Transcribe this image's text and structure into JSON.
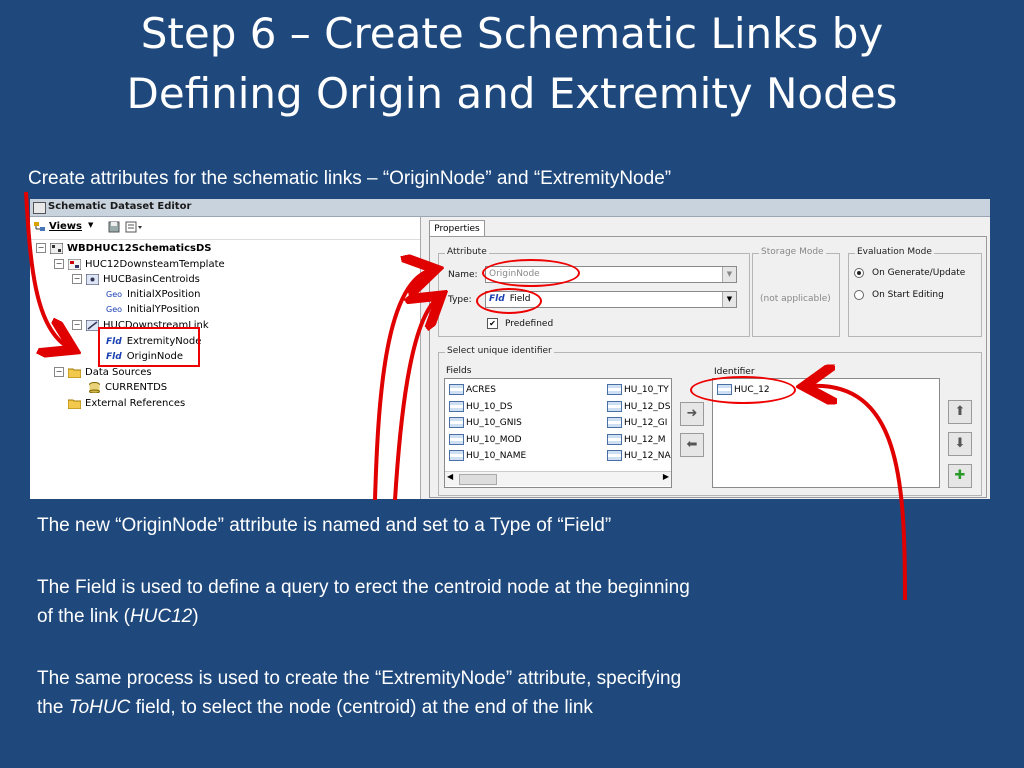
{
  "slide": {
    "title_line1": "Step 6 – Create Schematic Links by",
    "title_line2": "Defining Origin and Extremity Nodes",
    "subtitle": "Create attributes for the schematic links – “OriginNode” and “ExtremityNode”",
    "paragraph1": "The new “OriginNode” attribute is named and set to a Type of “Field”",
    "paragraph2_a": "The Field is used to define a query to erect the centroid node at the beginning",
    "paragraph2_b": "of the link (",
    "paragraph2_em": "HUC12",
    "paragraph2_c": ")",
    "paragraph3_a": "The same process is used to create the “ExtremityNode” attribute, specifying",
    "paragraph3_b": "the ",
    "paragraph3_em": "ToHUC",
    "paragraph3_c": " field, to select the node (centroid) at the end of the link",
    "highlight_color": "#e00000",
    "background_color": "#1f497d"
  },
  "window": {
    "title": "Schematic Dataset Editor",
    "toolbar": {
      "views_label": "Views"
    },
    "tree": {
      "root": "WBDHUC12SchematicsDS",
      "template": "HUC12DownsteamTemplate",
      "centroids": "HUCBasinCentroids",
      "initial_x": "InitialXPosition",
      "initial_y": "InitialYPosition",
      "link": "HUCDownstreamLink",
      "extremity": "ExtremityNode",
      "origin": "OriginNode",
      "data_sources": "Data Sources",
      "current_ds": "CURRENTDS",
      "external_refs": "External References",
      "fld_tag": "Fld",
      "geo_tag": "Geo"
    },
    "properties": {
      "tab_label": "Properties",
      "attribute_group": "Attribute",
      "name_label": "Name:",
      "name_value": "OriginNode",
      "type_label": "Type:",
      "type_tag": "Fld",
      "type_value": "Field",
      "predefined_label": "Predefined",
      "predefined_checked": true,
      "storage_group": "Storage Mode",
      "storage_value": "(not applicable)",
      "evaluation_group": "Evaluation Mode",
      "eval_option1": "On Generate/Update",
      "eval_option2": "On Start Editing",
      "eval_selected": "On Generate/Update",
      "unique_group": "Select unique identifier",
      "fields_label": "Fields",
      "identifier_label": "Identifier",
      "fields_col1": [
        "ACRES",
        "HU_10_DS",
        "HU_10_GNIS",
        "HU_10_MOD",
        "HU_10_NAME"
      ],
      "fields_col2": [
        "HU_10_TY",
        "HU_12_DS",
        "HU_12_GI",
        "HU_12_M",
        "HU_12_NA"
      ],
      "identifier_items": [
        "HUC_12"
      ]
    }
  }
}
